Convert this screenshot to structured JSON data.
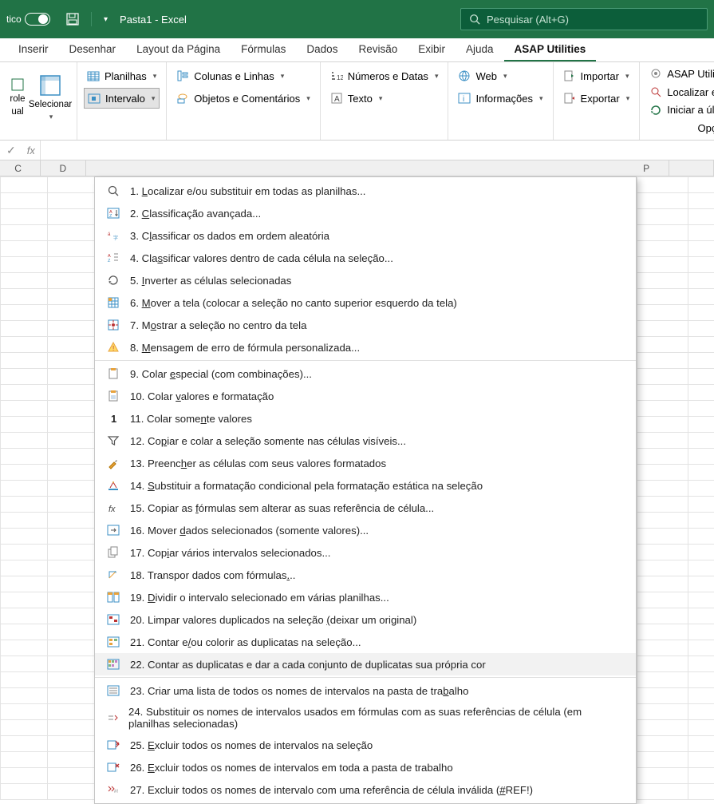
{
  "titlebar": {
    "toggle_label": "tico",
    "title": "Pasta1 - Excel"
  },
  "search": {
    "placeholder": "Pesquisar (Alt+G)"
  },
  "tabs": [
    "Inserir",
    "Desenhar",
    "Layout da Página",
    "Fórmulas",
    "Dados",
    "Revisão",
    "Exibir",
    "Ajuda",
    "ASAP Utilities"
  ],
  "active_tab": 8,
  "ribbon": {
    "big": {
      "role": "role",
      "selecionar": "Selecionar"
    },
    "col1": [
      "Planilhas",
      "Intervalo"
    ],
    "col2": [
      "Colunas e Linhas",
      "Objetos e Comentários"
    ],
    "col3": [
      "Números e Datas",
      "Texto"
    ],
    "col4": [
      "Web",
      "Informações"
    ],
    "col5": [
      "Importar",
      "Exportar"
    ],
    "col6": [
      "ASAP Utilitie",
      "Localizar e s",
      "Iniciar a últim",
      "Opçõe"
    ],
    "ual": "ual"
  },
  "columns": {
    "c": "C",
    "d": "D",
    "p": "P"
  },
  "menu": [
    {
      "n": "1",
      "t": "Localizar e/ou substituir em todas as planilhas...",
      "u": "L",
      "icon": "search"
    },
    {
      "n": "2",
      "t": "Classificação avançada...",
      "u": "C",
      "icon": "sort-az"
    },
    {
      "n": "3",
      "t": "Classificar os dados em ordem aleatória",
      "u": "l",
      "icon": "random"
    },
    {
      "n": "4",
      "t": "Classificar valores dentro de cada célula na seleção...",
      "u": "s",
      "icon": "azcell"
    },
    {
      "n": "5",
      "t": "Inverter as células selecionadas",
      "u": "I",
      "icon": "refresh"
    },
    {
      "n": "6",
      "t": "Mover a tela (colocar a seleção no canto superior esquerdo da tela)",
      "u": "M",
      "icon": "grid"
    },
    {
      "n": "7",
      "t": "Mostrar a seleção no centro da tela",
      "u": "o",
      "icon": "target"
    },
    {
      "n": "8",
      "t": "Mensagem de erro de fórmula personalizada...",
      "u": "M",
      "icon": "warn"
    },
    {
      "n": "9",
      "t": "Colar especial (com combinações)...",
      "u": "e",
      "icon": "paste"
    },
    {
      "n": "10",
      "t": "Colar valores e formatação",
      "u": "v",
      "icon": "pastef"
    },
    {
      "n": "11",
      "t": "Colar somente valores",
      "u": "n",
      "icon": "one"
    },
    {
      "n": "12",
      "t": "Copiar e colar a seleção somente nas células visíveis...",
      "u": "p",
      "icon": "funnel"
    },
    {
      "n": "13",
      "t": "Preencher as células com seus valores formatados",
      "u": "h",
      "icon": "brush"
    },
    {
      "n": "14",
      "t": "Substituir a formatação condicional pela formatação estática na seleção",
      "u": "S",
      "icon": "palette"
    },
    {
      "n": "15",
      "t": "Copiar as fórmulas sem alterar as suas referência de célula...",
      "u": "f",
      "icon": "fx"
    },
    {
      "n": "16",
      "t": "Mover dados selecionados (somente valores)...",
      "u": "d",
      "icon": "move"
    },
    {
      "n": "17",
      "t": "Copiar vários intervalos selecionados...",
      "u": "i",
      "icon": "copymulti"
    },
    {
      "n": "18",
      "t": "Transpor dados com fórmulas...",
      "u": ".",
      "icon": "transpose"
    },
    {
      "n": "19",
      "t": "Dividir o intervalo selecionado em várias planilhas...",
      "u": "D",
      "icon": "split"
    },
    {
      "n": "20",
      "t": "Limpar valores duplicados na seleção (deixar um original)",
      "u": "(",
      "icon": "dup"
    },
    {
      "n": "21",
      "t": "Contar e/ou colorir as duplicatas na seleção...",
      "u": "/",
      "icon": "colordup"
    },
    {
      "n": "22",
      "t": "Contar as duplicatas e dar a cada conjunto de duplicatas sua própria cor",
      "u": "2",
      "icon": "colorgroup",
      "hover": true
    },
    {
      "n": "23",
      "t": "Criar uma lista de todos os nomes de intervalos na pasta de trabalho",
      "u": "b",
      "icon": "list"
    },
    {
      "n": "24",
      "t": "Substituir os nomes de intervalos usados em fórmulas com as suas referências de célula (em planilhas selecionadas)",
      "u": "4",
      "icon": "replace"
    },
    {
      "n": "25",
      "t": "Excluir todos os nomes de intervalos na seleção",
      "u": "E",
      "icon": "delname"
    },
    {
      "n": "26",
      "t": "Excluir todos os nomes de intervalos em toda a pasta de trabalho",
      "u": "E",
      "icon": "delname2"
    },
    {
      "n": "27",
      "t": "Excluir todos os nomes de intervalo com uma referência de célula inválida (#REF!)",
      "u": "#",
      "icon": "delref"
    }
  ]
}
